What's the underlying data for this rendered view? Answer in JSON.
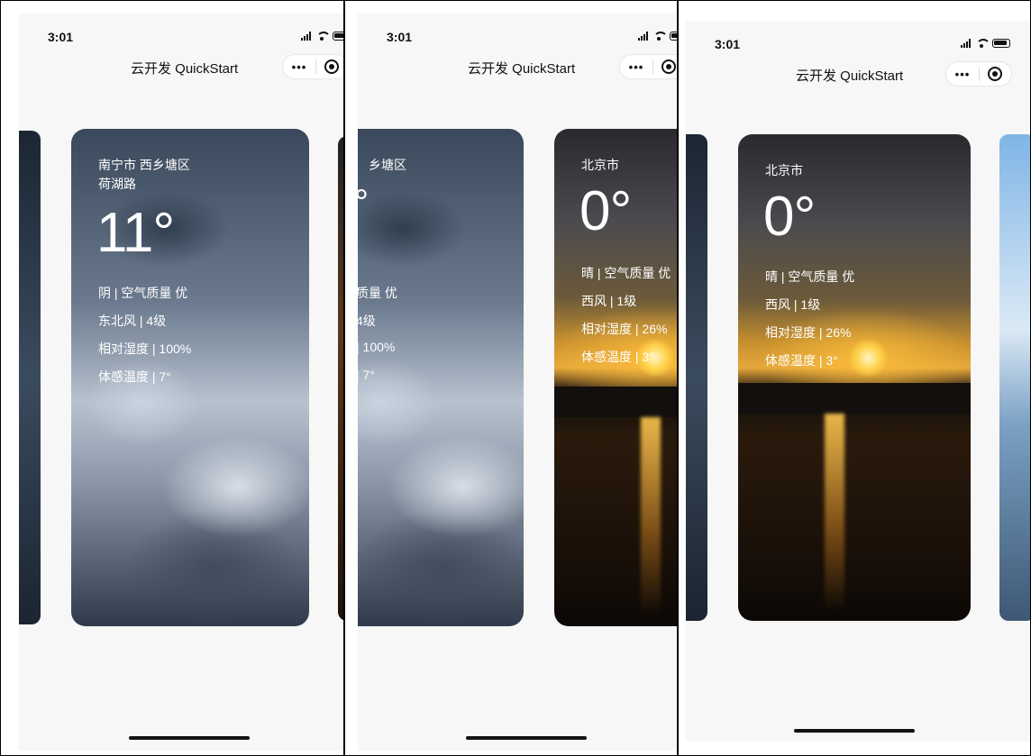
{
  "status": {
    "time": "3:01"
  },
  "nav": {
    "title": "云开发 QuickStart",
    "more_label": "•••"
  },
  "cards": {
    "nanning": {
      "city_line1": "南宁市 西乡塘区",
      "city_line2": "荷湖路",
      "temp": "11°",
      "weather": "阴 | 空气质量 优",
      "wind": "东北风 | 4级",
      "humidity": "相对湿度 | 100%",
      "feels": "体感温度 | 7°"
    },
    "nanning_partial": {
      "city": "乡塘区",
      "temp": "°",
      "weather": "质量 优",
      "wind": "4级",
      "humidity": "| 100%",
      "feels": "| 7°"
    },
    "beijing": {
      "city": "北京市",
      "temp": "0°",
      "weather": "晴 | 空气质量 优",
      "wind": "西风 | 1级",
      "humidity": "相对湿度 | 26%",
      "feels": "体感温度 | 3°"
    },
    "beijing_partial": {
      "weather": "晴 | 空气质量 优"
    }
  }
}
